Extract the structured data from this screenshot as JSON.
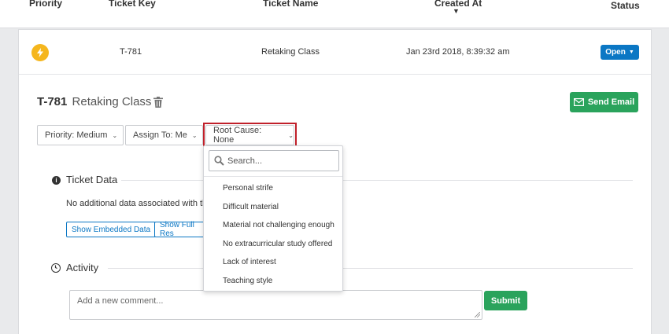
{
  "table_header": {
    "priority": "Priority",
    "ticket_key": "Ticket Key",
    "ticket_name": "Ticket Name",
    "created_at": "Created At",
    "sort_arrow": "▼",
    "status": "Status"
  },
  "row": {
    "priority_icon": "lightning-bolt-icon",
    "ticket_key": "T-781",
    "ticket_name": "Retaking Class",
    "created_at": "Jan 23rd 2018, 8:39:32 am",
    "status_label": "Open"
  },
  "detail": {
    "key": "T-781",
    "name": "Retaking Class",
    "send_email_label": "Send Email"
  },
  "filters": {
    "priority_label": "Priority: Medium",
    "assign_label": "Assign To: Me",
    "root_cause_label": "Root Cause: None"
  },
  "ticket_data": {
    "heading": "Ticket Data",
    "empty_text": "No additional data associated with thi",
    "show_embedded_label": "Show Embedded Data",
    "show_full_label": "Show Full Res"
  },
  "activity": {
    "heading": "Activity",
    "comment_placeholder": "Add a new comment...",
    "submit_label": "Submit"
  },
  "root_cause_dropdown": {
    "search_placeholder": "Search...",
    "options": [
      "Personal strife",
      "Difficult material",
      "Material not challenging enough",
      "No extracurricular study offered",
      "Lack of interest",
      "Teaching style"
    ]
  },
  "colors": {
    "accent_blue": "#0b77c4",
    "action_green": "#2aa35c",
    "priority_yellow": "#f5b61d",
    "highlight_red": "#c0202a"
  }
}
